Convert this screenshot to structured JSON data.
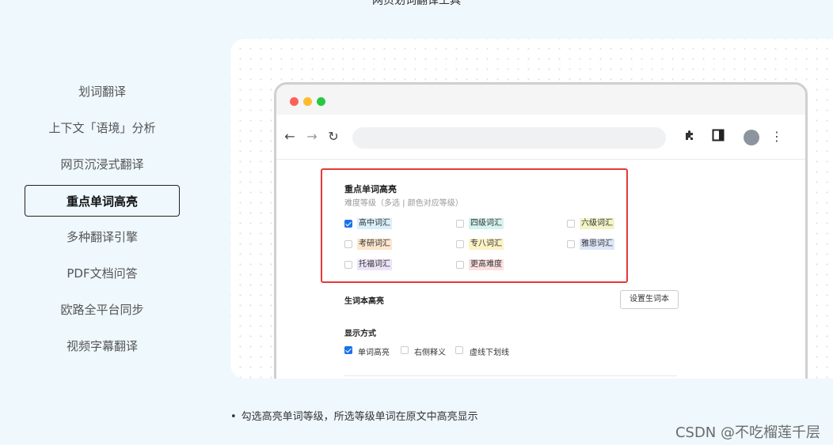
{
  "page": {
    "top_title": "网页划词翻译工具"
  },
  "sidebar": {
    "items": [
      {
        "label": "划词翻译"
      },
      {
        "label": "上下文「语境」分析"
      },
      {
        "label": "网页沉浸式翻译"
      },
      {
        "label": "重点单词高亮",
        "active": true
      },
      {
        "label": "多种翻译引擎"
      },
      {
        "label": "PDF文档问答"
      },
      {
        "label": "欧路全平台同步"
      },
      {
        "label": "视频字幕翻译"
      }
    ]
  },
  "browser": {
    "settings": {
      "highlight": {
        "title": "重点单词高亮",
        "subtitle": "难度等级（多选 | 颜色对应等级）",
        "options": [
          {
            "label": "高中词汇",
            "checked": true,
            "color": "#d9f0fb"
          },
          {
            "label": "四级词汇",
            "checked": false,
            "color": "#d5f3ef"
          },
          {
            "label": "六级词汇",
            "checked": false,
            "color": "#f3f4c7"
          },
          {
            "label": "考研词汇",
            "checked": false,
            "color": "#fde6cd"
          },
          {
            "label": "专八词汇",
            "checked": false,
            "color": "#fdf2c6"
          },
          {
            "label": "雅思词汇",
            "checked": false,
            "color": "#dde6f8"
          },
          {
            "label": "托福词汇",
            "checked": false,
            "color": "#ebe3f7"
          },
          {
            "label": "更高难度",
            "checked": false,
            "color": "#fbe0e0"
          }
        ]
      },
      "wordbook": {
        "title": "生词本高亮",
        "button": "设置生词本"
      },
      "display": {
        "title": "显示方式",
        "options": [
          {
            "label": "单词高亮",
            "checked": true
          },
          {
            "label": "右侧释义",
            "checked": false
          },
          {
            "label": "虚线下划线",
            "checked": false
          }
        ]
      }
    }
  },
  "footer": {
    "bullet": "勾选高亮单词等级，所选等级单词在原文中高亮显示",
    "watermark": "CSDN @不吃榴莲千层"
  },
  "colors": {
    "accent": "#1a73e8",
    "highlight_border": "#e53935",
    "page_bg": "#eef8fd"
  }
}
